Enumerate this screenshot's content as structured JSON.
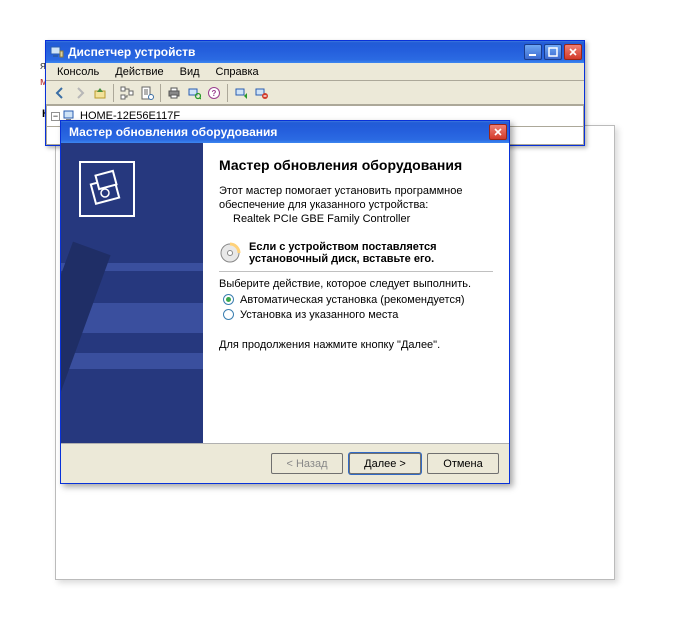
{
  "bg_fragments": [
    "я",
    "м",
    "К"
  ],
  "devmgr": {
    "title": "Диспетчер устройств",
    "menus": {
      "console": "Консоль",
      "action": "Действие",
      "view": "Вид",
      "help": "Справка"
    },
    "toolbar": {
      "back": "back-icon",
      "fwd": "forward-icon",
      "up": "up-icon",
      "props": "properties-icon",
      "refresh": "refresh-icon",
      "scan": "scan-hardware-icon",
      "uninstall": "uninstall-icon"
    },
    "root_node": "HOME-12E56E117F"
  },
  "wizard": {
    "title": "Мастер обновления оборудования",
    "heading": "Мастер обновления оборудования",
    "intro1": "Этот мастер помогает установить программное",
    "intro2": "обеспечение для указанного устройства:",
    "device": "Realtek PCIe GBE Family Controller",
    "cd_hint1": "Если с устройством поставляется",
    "cd_hint2": "установочный диск, вставьте его.",
    "choose": "Выберите действие, которое следует выполнить.",
    "radio_auto": "Автоматическая установка (рекомендуется)",
    "radio_manual": "Установка из указанного места",
    "continue_hint": "Для продолжения нажмите кнопку \"Далее\".",
    "btn_back": "< Назад",
    "btn_next": "Далее >",
    "btn_cancel": "Отмена"
  },
  "titlebar_btns": {
    "min": "minimize-icon",
    "max": "maximize-icon",
    "close": "close-icon"
  }
}
